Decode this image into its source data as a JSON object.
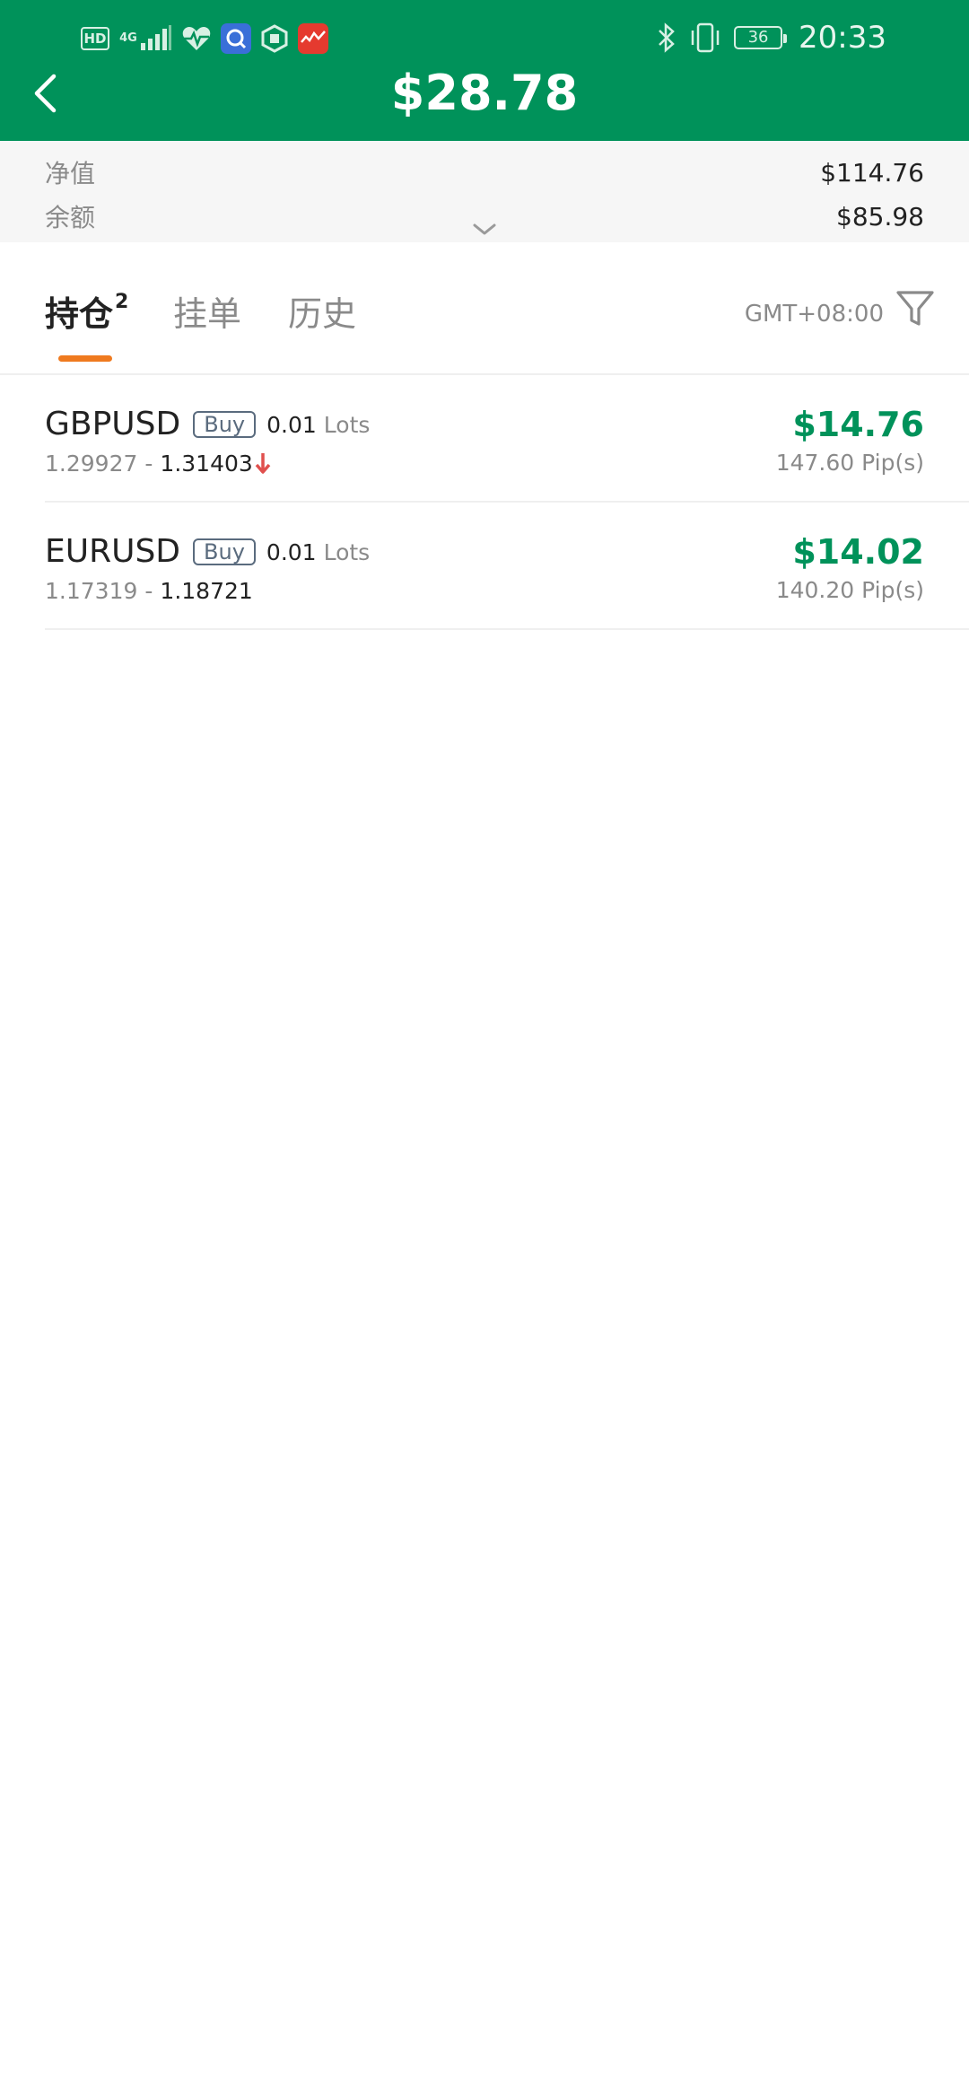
{
  "status_bar": {
    "left_icons": [
      "hd-badge",
      "4g-signal-icon",
      "heart-rate-icon",
      "app-q-icon",
      "app-hexagon-icon",
      "app-red-icon"
    ],
    "network_label": "4G",
    "hd_label": "HD",
    "right_icons": [
      "bluetooth-icon",
      "vibrate-icon",
      "battery-icon"
    ],
    "battery_level": "36",
    "time": "20:33"
  },
  "header": {
    "title": "$28.78",
    "back_icon": "chevron-left-icon"
  },
  "summary": {
    "equity_label": "净值",
    "equity_value": "$114.76",
    "balance_label": "余额",
    "balance_value": "$85.98",
    "expand_icon": "chevron-down-icon"
  },
  "tabs": {
    "items": [
      {
        "label": "持仓",
        "count": "2",
        "active": true
      },
      {
        "label": "挂单",
        "active": false
      },
      {
        "label": "历史",
        "active": false
      }
    ],
    "timezone": "GMT+08:00",
    "filter_icon": "filter-icon"
  },
  "positions": [
    {
      "symbol": "GBPUSD",
      "side": "Buy",
      "lots": "0.01",
      "lots_unit": "Lots",
      "open_price": "1.29927",
      "separator": "-",
      "current_price": "1.31403",
      "trend": "down",
      "pnl": "$14.76",
      "pips": "147.60 Pip(s)"
    },
    {
      "symbol": "EURUSD",
      "side": "Buy",
      "lots": "0.01",
      "lots_unit": "Lots",
      "open_price": "1.17319",
      "separator": "-",
      "current_price": "1.18721",
      "trend": "",
      "pnl": "$14.02",
      "pips": "140.20 Pip(s)"
    }
  ],
  "colors": {
    "brand_green": "#00925a",
    "tab_indicator": "#ef7a1f",
    "price_down": "#e0504e",
    "muted_text": "#8a8a8a",
    "badge_border": "#5a6b7e"
  }
}
